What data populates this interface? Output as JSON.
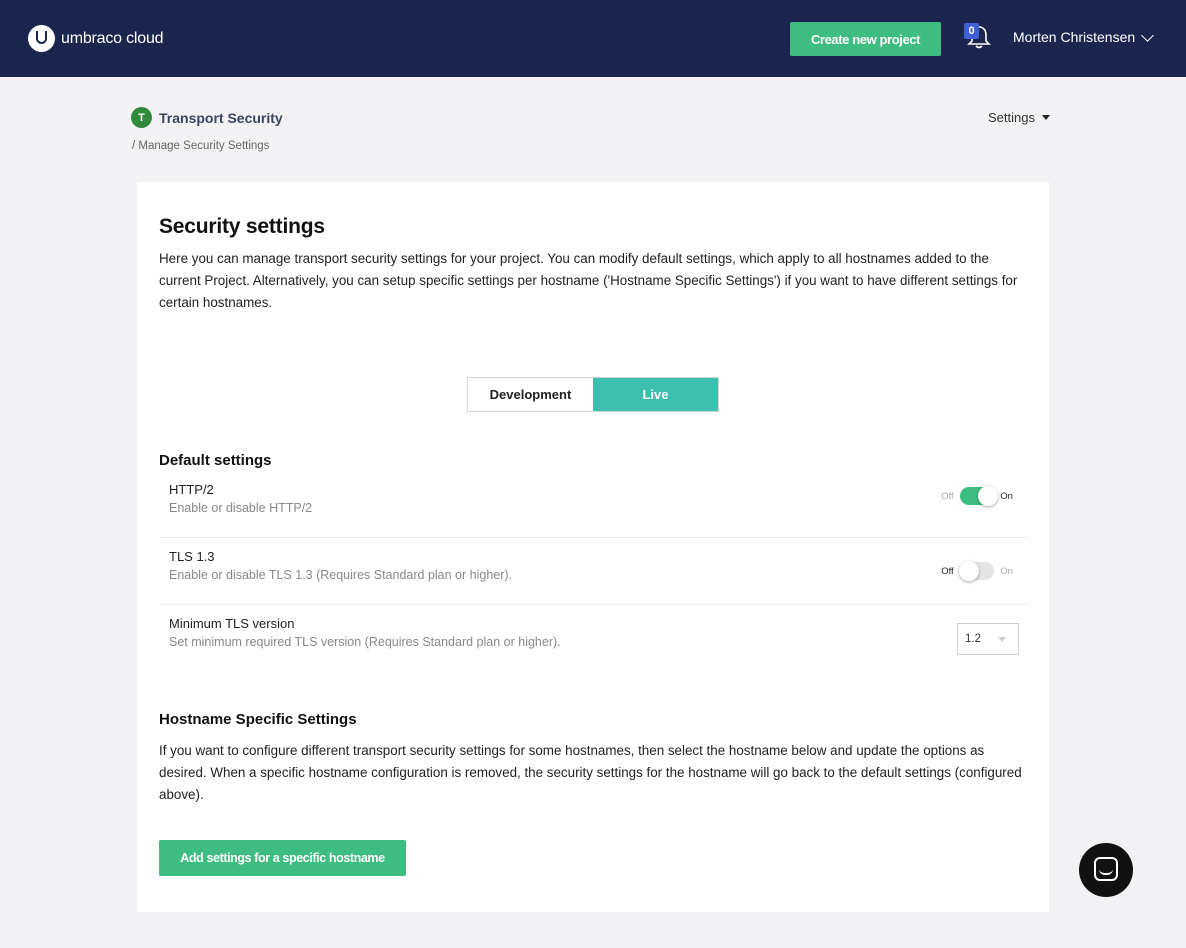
{
  "topbar": {
    "brand_bold": "umbraco",
    "brand_light": "cloud",
    "create_label": "Create new project",
    "notification_count": "0",
    "user_name": "Morten Christensen",
    "bg_color": "#1b264f",
    "accent_color": "#3ebd80",
    "icons": [
      "umbraco-logo-icon",
      "bell-icon",
      "chevron-down-icon",
      "chat-icon"
    ]
  },
  "project": {
    "badge": "T",
    "name": "Transport Security",
    "breadcrumb": "/ Manage Security Settings",
    "settings_label": "Settings"
  },
  "card": {
    "title": "Security settings",
    "intro": "Here you can manage transport security settings for your project. You can modify default settings, which apply to all hostnames added to the current Project. Alternatively, you can setup specific settings per hostname ('Hostname Specific Settings') if you want to have different settings for certain hostnames.",
    "env_tabs": [
      {
        "label": "Development",
        "active": false
      },
      {
        "label": "Live",
        "active": true
      }
    ],
    "default_heading": "Default settings",
    "settings": [
      {
        "title": "HTTP/2",
        "desc": "Enable or disable HTTP/2",
        "type": "toggle",
        "off": "Off",
        "on": "On",
        "enabled": true
      },
      {
        "title": "TLS 1.3",
        "desc": "Enable or disable TLS 1.3 (Requires Standard plan or higher).",
        "type": "toggle",
        "off": "Off",
        "on": "On",
        "enabled": false
      },
      {
        "title": "Minimum TLS version",
        "desc": "Set minimum required TLS version (Requires Standard plan or higher).",
        "type": "select",
        "value": "1.2"
      }
    ],
    "hostname_heading": "Hostname Specific Settings",
    "hostname_text": "If you want to configure different transport security settings for some hostnames, then select the hostname below and update the options as desired. When a specific hostname configuration is removed, the security settings for the hostname will go back to the default settings (configured above).",
    "add_button": "Add settings for a specific hostname"
  }
}
